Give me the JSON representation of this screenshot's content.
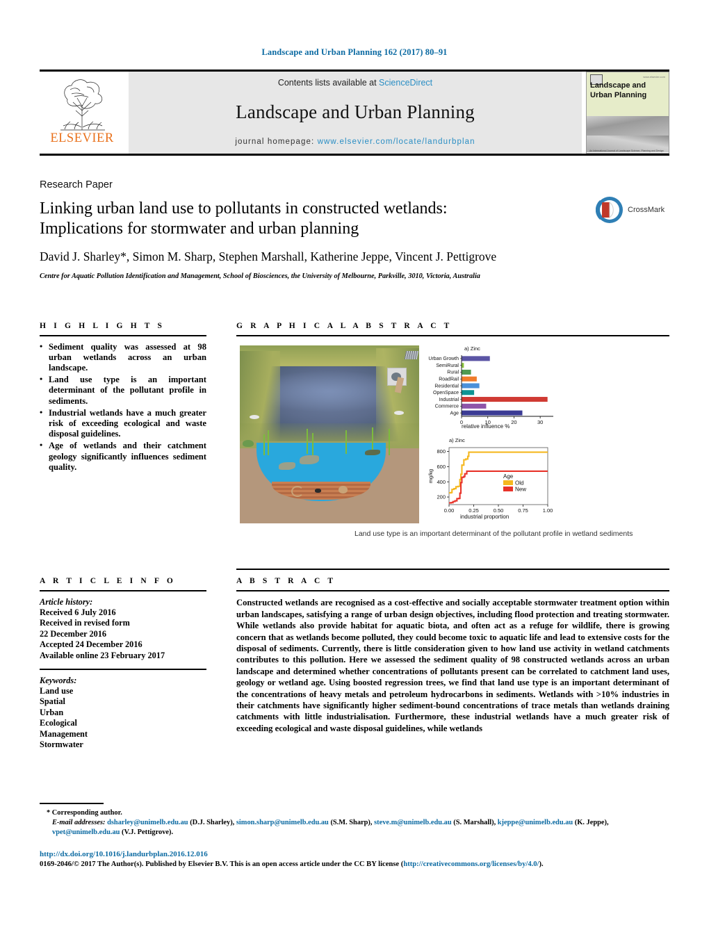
{
  "running_head": "Landscape and Urban Planning 162 (2017) 80–91",
  "masthead": {
    "publisher": "ELSEVIER",
    "contents_prefix": "Contents lists available at ",
    "contents_link": "ScienceDirect",
    "journal_title": "Landscape and Urban Planning",
    "homepage_label": "journal homepage:",
    "homepage_url": "www.elsevier.com/locate/landurbplan",
    "cover_title_line1": "Landscape and",
    "cover_title_line2": "Urban Planning",
    "cover_footer": "An International Journal of Landscape Science, Planning and Design"
  },
  "article": {
    "type": "Research Paper",
    "title": "Linking urban land use to pollutants in constructed wetlands: Implications for stormwater and urban planning",
    "authors": "David J. Sharley*, Simon M. Sharp, Stephen Marshall, Katherine Jeppe, Vincent J. Pettigrove",
    "affiliation": "Centre for Aquatic Pollution Identification and Management, School of Biosciences, the University of Melbourne, Parkville, 3010, Victoria, Australia",
    "crossmark_label": "CrossMark"
  },
  "highlights": {
    "heading": "H I G H L I G H T S",
    "items": [
      "Sediment quality was assessed at 98 urban wetlands across an urban landscape.",
      "Land use type is an important determinant of the pollutant profile in sediments.",
      "Industrial wetlands have a much greater risk of exceeding ecological and waste disposal guidelines.",
      "Age of wetlands and their catchment geology significantly influences sediment quality."
    ]
  },
  "graphical_abstract": {
    "heading": "G R A P H I C A L   A B S T R A C T",
    "caption": "Land use type is an important determinant of the pollutant profile in wetland sediments"
  },
  "article_info": {
    "heading": "A R T I C L E   I N F O",
    "history_label": "Article history:",
    "history": [
      "Received 6 July 2016",
      "Received in revised form",
      "22 December 2016",
      "Accepted 24 December 2016",
      "Available online 23 February 2017"
    ],
    "keywords_label": "Keywords:",
    "keywords": [
      "Land use",
      "Spatial",
      "Urban",
      "Ecological",
      "Management",
      "Stormwater"
    ]
  },
  "abstract": {
    "heading": "A B S T R A C T",
    "text": "Constructed wetlands are recognised as a cost-effective and socially acceptable stormwater treatment option within urban landscapes, satisfying a range of urban design objectives, including flood protection and treating stormwater. While wetlands also provide habitat for aquatic biota, and often act as a refuge for wildlife, there is growing concern that as wetlands become polluted, they could become toxic to aquatic life and lead to extensive costs for the disposal of sediments. Currently, there is little consideration given to how land use activity in wetland catchments contributes to this pollution. Here we assessed the sediment quality of 98 constructed wetlands across an urban landscape and determined whether concentrations of pollutants present can be correlated to catchment land uses, geology or wetland age. Using boosted regression trees, we find that land use type is an important determinant of the concentrations of heavy metals and petroleum hydrocarbons in sediments. Wetlands with >10% industries in their catchments have significantly higher sediment-bound concentrations of trace metals than wetlands draining catchments with little industrialisation. Furthermore, these industrial wetlands have a much greater risk of exceeding ecological and waste disposal guidelines, while wetlands"
  },
  "footer": {
    "corresponding": "* Corresponding author.",
    "email_label": "E-mail addresses:",
    "emails": [
      {
        "address": "dsharley@unimelb.edu.au",
        "name": "(D.J. Sharley)"
      },
      {
        "address": "simon.sharp@unimelb.edu.au",
        "name": "(S.M. Sharp)"
      },
      {
        "address": "steve.m@unimelb.edu.au",
        "name": "(S. Marshall)"
      },
      {
        "address": "kjeppe@unimelb.edu.au",
        "name": "(K. Jeppe)"
      },
      {
        "address": "vpet@unimelb.edu.au",
        "name": "(V.J. Pettigrove)"
      }
    ],
    "doi": "http://dx.doi.org/10.1016/j.landurbplan.2016.12.016",
    "copyright_pre": "0169-2046/© 2017 The Author(s). Published by Elsevier B.V. This is an open access article under the CC BY license (",
    "license_url": "http://creativecommons.org/licenses/by/4.0/",
    "copyright_post": ")."
  },
  "chart_data": [
    {
      "type": "bar",
      "id": "relative-influence-zinc",
      "title": "a) Zinc",
      "orientation": "horizontal",
      "categories": [
        "Urban Growth",
        "SemiRural",
        "Rural",
        "RoadRail",
        "Residential",
        "OpenSpace",
        "Industrial",
        "Commerce",
        "Age"
      ],
      "values": [
        10.8,
        0.9,
        3.6,
        5.8,
        6.8,
        4.8,
        32.8,
        9.4,
        23.2
      ],
      "colors": [
        "#5B55A5",
        "#8DC63F",
        "#4E9A51",
        "#F07C2B",
        "#4A90D9",
        "#0E9494",
        "#D03A33",
        "#8E55A8",
        "#3B3B94"
      ],
      "xlabel": "relative influence %",
      "ylabel": "",
      "xticks": [
        0,
        10,
        20,
        30
      ],
      "xlim": [
        0,
        35
      ],
      "grid": false,
      "legend": "none"
    },
    {
      "type": "line",
      "id": "partial-dependence-zinc",
      "title": "a) Zinc",
      "xlabel": "industrial proportion",
      "ylabel": "mg/kg",
      "xticks": [
        "0.00",
        "0.25",
        "0.50",
        "0.75",
        "1.00"
      ],
      "yticks": [
        200,
        400,
        600,
        800
      ],
      "xlim": [
        0,
        1.0
      ],
      "ylim": [
        100,
        850
      ],
      "grid": false,
      "legend_title": "Age",
      "series": [
        {
          "name": "Old",
          "color": "#F5B820",
          "x": [
            0.0,
            0.02,
            0.03,
            0.05,
            0.07,
            0.09,
            0.11,
            0.12,
            0.13,
            0.15,
            0.17,
            0.19,
            0.2,
            1.0
          ],
          "y": [
            255,
            258,
            300,
            310,
            335,
            340,
            430,
            500,
            620,
            690,
            700,
            735,
            790,
            790
          ]
        },
        {
          "name": "New",
          "color": "#E8332A",
          "x": [
            0.0,
            0.02,
            0.04,
            0.06,
            0.08,
            0.1,
            0.11,
            0.12,
            0.13,
            0.15,
            0.16,
            0.18,
            1.0
          ],
          "y": [
            122,
            126,
            140,
            150,
            178,
            182,
            250,
            390,
            460,
            470,
            505,
            540,
            540
          ]
        }
      ]
    }
  ]
}
